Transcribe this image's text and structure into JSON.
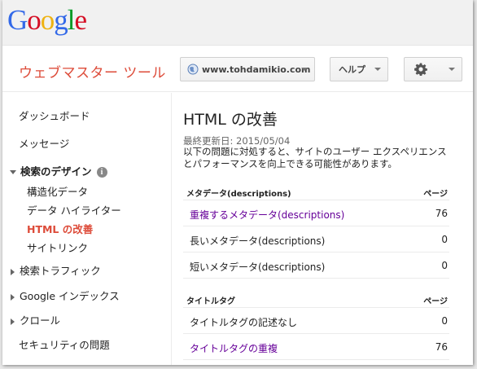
{
  "logo": {
    "letters": [
      "G",
      "o",
      "o",
      "g",
      "l",
      "e"
    ],
    "colors": [
      "#3369e8",
      "#d50f25",
      "#eeb211",
      "#3369e8",
      "#009925",
      "#d50f25"
    ]
  },
  "header": {
    "app_title": "ウェブマスター ツール",
    "site_selector": "www.tohdamikio.com",
    "help_label": "ヘルプ",
    "settings_icon": "gear-icon",
    "globe_icon": "globe-icon"
  },
  "sidebar": {
    "dashboard": "ダッシュボード",
    "messages": "メッセージ",
    "search_appearance": "検索のデザイン",
    "search_appearance_info": "i",
    "structured_data": "構造化データ",
    "data_highlighter": "データ ハイライター",
    "html_improvements": "HTML の改善",
    "sitelinks": "サイトリンク",
    "search_traffic": "検索トラフィック",
    "google_index": "Google インデックス",
    "crawl": "クロール",
    "security_issues": "セキュリティの問題"
  },
  "main": {
    "title": "HTML の改善",
    "last_updated": "最終更新日: 2015/05/04",
    "description": "以下の問題に対処すると、サイトのユーザー エクスペリエンスとパフォーマンスを向上できる可能性があります。",
    "meta_table": {
      "header_label": "メタデータ(descriptions)",
      "header_pages": "ページ",
      "rows": [
        {
          "label": "重複するメタデータ(descriptions)",
          "count": "76",
          "link": true
        },
        {
          "label": "長いメタデータ(descriptions)",
          "count": "0",
          "link": false
        },
        {
          "label": "短いメタデータ(descriptions)",
          "count": "0",
          "link": false
        }
      ]
    },
    "title_table": {
      "header_label": "タイトルタグ",
      "header_pages": "ページ",
      "rows": [
        {
          "label": "タイトルタグの記述なし",
          "count": "0",
          "link": false
        },
        {
          "label": "タイトルタグの重複",
          "count": "76",
          "link": true
        }
      ]
    }
  },
  "colors": {
    "accent_red": "#dd4b39",
    "link_purple": "#660099"
  }
}
